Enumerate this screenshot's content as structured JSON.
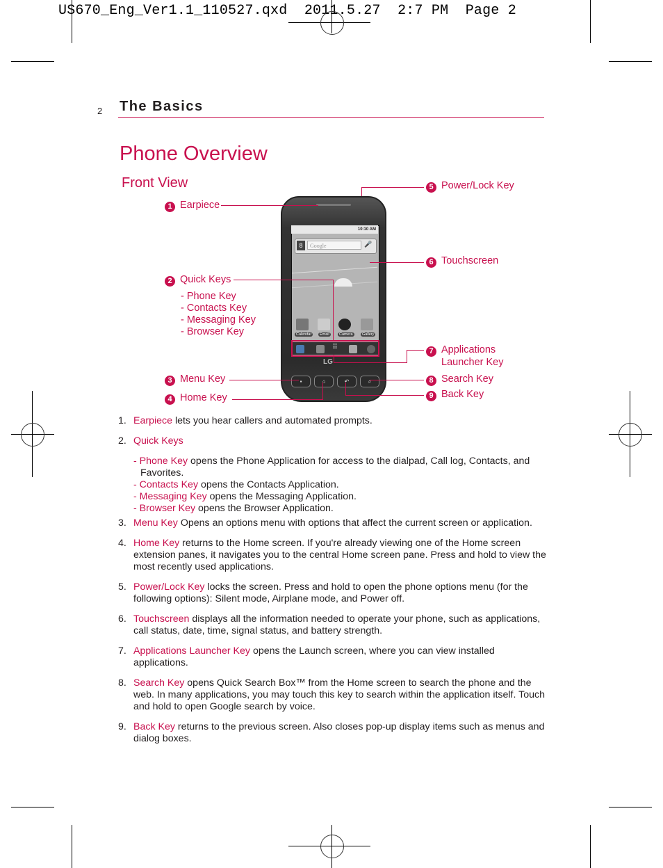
{
  "slug": "US670_Eng_Ver1.1_110527.qxd  2011.5.27  2:7 PM  Page 2",
  "header": {
    "page_number": "2",
    "section": "The Basics"
  },
  "title": "Phone Overview",
  "subtitle": "Front View",
  "accent_color": "#c8104e",
  "callouts": [
    {
      "n": "1",
      "label": "Earpiece"
    },
    {
      "n": "2",
      "label": "Quick Keys",
      "subitems": [
        "- Phone Key",
        "- Contacts Key",
        "- Messaging Key",
        "- Browser Key"
      ]
    },
    {
      "n": "3",
      "label": "Menu Key"
    },
    {
      "n": "4",
      "label": "Home Key"
    },
    {
      "n": "5",
      "label": "Power/Lock Key"
    },
    {
      "n": "6",
      "label": "Touchscreen"
    },
    {
      "n": "7",
      "label": "Applications",
      "label2": "Launcher Key"
    },
    {
      "n": "8",
      "label": "Search Key"
    },
    {
      "n": "9",
      "label": "Back Key"
    }
  ],
  "phone": {
    "status_time": "10:10 AM",
    "search_placeholder": "Google",
    "search_logo": "8",
    "mic_icon": "🎤",
    "apps": [
      "Calendar",
      "Email",
      "Camera",
      "Gallery"
    ],
    "dock_launcher_icon": "⠿",
    "brand": "LG",
    "hw_keys": {
      "menu": "▪",
      "home": "⌂",
      "back": "↶",
      "search": "⌕"
    }
  },
  "items": [
    {
      "num": "1.",
      "term": "Earpiece",
      "text": " lets you hear callers and automated prompts."
    },
    {
      "num": "2.",
      "term": "Quick Keys",
      "text": "",
      "subs": [
        {
          "term": "- Phone Key",
          "text": " opens the Phone Application for access to the dialpad, Call log, Contacts, and Favorites."
        },
        {
          "term": "- Contacts Key",
          "text": " opens the Contacts Application."
        },
        {
          "term": "- Messaging Key",
          "text": " opens the Messaging Application."
        },
        {
          "term": "- Browser Key",
          "text": " opens the Browser Application."
        }
      ]
    },
    {
      "num": "3.",
      "term": "Menu Key",
      "text": " Opens an options menu with options that affect the current screen or application."
    },
    {
      "num": "4.",
      "term": "Home Key",
      "text": " returns to the Home screen. If you're already viewing one of the Home screen extension panes, it navigates you to the central Home screen pane. Press and hold to view the most recently used applications."
    },
    {
      "num": "5.",
      "term": "Power/Lock Key",
      "text": " locks the screen. Press and hold to open the phone options menu (for the following options): Silent mode, Airplane mode, and Power off."
    },
    {
      "num": "6.",
      "term": "Touchscreen",
      "text": " displays all the information needed to operate your phone, such as applications, call status, date, time, signal status, and battery strength."
    },
    {
      "num": "7.",
      "term": "Applications Launcher Key",
      "text": " opens the Launch screen, where you can view installed applications."
    },
    {
      "num": "8.",
      "term": "Search Key",
      "text": " opens Quick Search Box™ from the Home screen to search the phone and the web. In many applications, you may touch this key to search within the application itself. Touch and hold to open Google search by voice."
    },
    {
      "num": "9.",
      "term": "Back Key",
      "text": " returns to the previous screen. Also closes pop-up display items such as menus and dialog boxes."
    }
  ]
}
